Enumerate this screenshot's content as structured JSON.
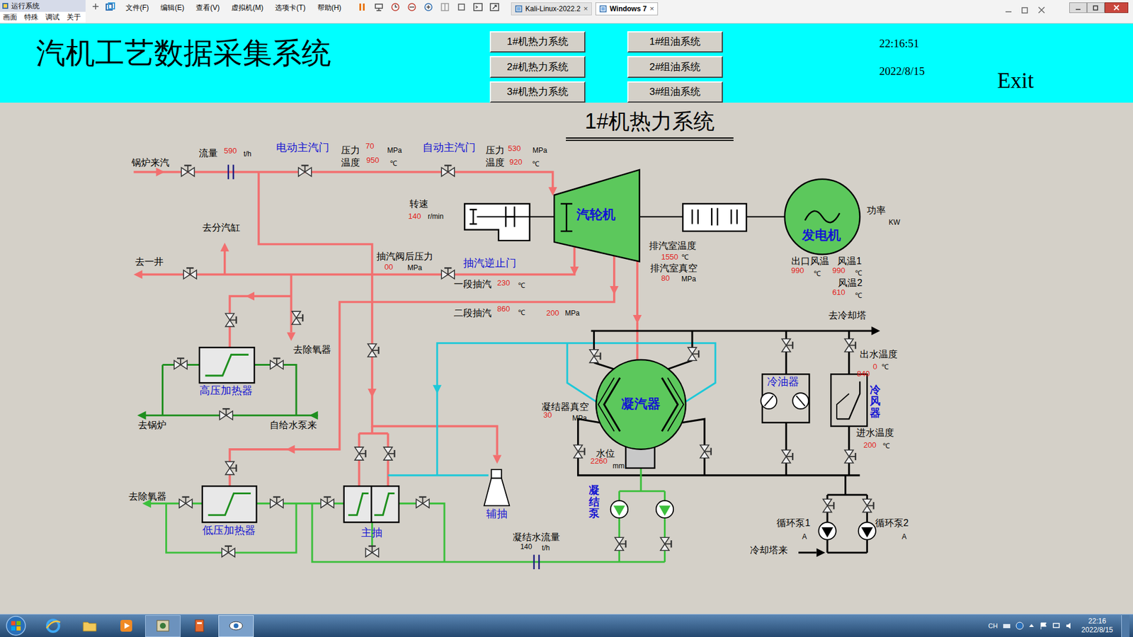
{
  "vm": {
    "app_title": "运行系统",
    "app_menu": [
      "画面",
      "特殊",
      "调试",
      "关于"
    ],
    "menu": [
      "文件(F)",
      "编辑(E)",
      "查看(V)",
      "虚拟机(M)",
      "选项卡(T)",
      "帮助(H)"
    ],
    "tabs": [
      {
        "label": "Kali-Linux-2022.2",
        "close": "×",
        "selected": false
      },
      {
        "label": "Windows 7",
        "close": "×",
        "selected": true
      }
    ]
  },
  "header": {
    "title": "汽机工艺数据采集系统",
    "nav": [
      "1#机热力系统",
      "2#机热力系统",
      "3#机热力系统",
      "1#组油系统",
      "2#组油系统",
      "3#组油系统"
    ],
    "time": "22:16:51",
    "date": "2022/8/15",
    "exit": "Exit"
  },
  "diagram": {
    "title": "1#机热力系统",
    "labels": [
      {
        "text": "锅炉来汽",
        "kind": "label"
      },
      {
        "text": "流量",
        "kind": "label"
      },
      {
        "text": "590",
        "kind": "value"
      },
      {
        "text": "t/h",
        "kind": "unit"
      },
      {
        "text": "电动主汽门",
        "kind": "name"
      },
      {
        "text": "压力",
        "kind": "label"
      },
      {
        "text": "70",
        "kind": "value"
      },
      {
        "text": "MPa",
        "kind": "unit"
      },
      {
        "text": "温度",
        "kind": "label"
      },
      {
        "text": "950",
        "kind": "value"
      },
      {
        "text": "℃",
        "kind": "unit"
      },
      {
        "text": "自动主汽门",
        "kind": "name"
      },
      {
        "text": "压力",
        "kind": "label"
      },
      {
        "text": "530",
        "kind": "value"
      },
      {
        "text": "MPa",
        "kind": "unit"
      },
      {
        "text": "温度",
        "kind": "label"
      },
      {
        "text": "920",
        "kind": "value"
      },
      {
        "text": "℃",
        "kind": "unit"
      },
      {
        "text": "转速",
        "kind": "label"
      },
      {
        "text": "140",
        "kind": "value"
      },
      {
        "text": "r/min",
        "kind": "unit"
      },
      {
        "text": "汽轮机",
        "kind": "bold"
      },
      {
        "text": "发电机",
        "kind": "bold"
      },
      {
        "text": "功率",
        "kind": "label"
      },
      {
        "text": "KW",
        "kind": "unit"
      },
      {
        "text": "排汽室温度",
        "kind": "label"
      },
      {
        "text": "1550",
        "kind": "value"
      },
      {
        "text": "℃",
        "kind": "unit"
      },
      {
        "text": "排汽室真空",
        "kind": "label"
      },
      {
        "text": "80",
        "kind": "value"
      },
      {
        "text": "MPa",
        "kind": "unit"
      },
      {
        "text": "出口风温",
        "kind": "label"
      },
      {
        "text": "990",
        "kind": "value"
      },
      {
        "text": "℃",
        "kind": "unit"
      },
      {
        "text": "风温1",
        "kind": "label"
      },
      {
        "text": "990",
        "kind": "value"
      },
      {
        "text": "℃",
        "kind": "unit"
      },
      {
        "text": "风温2",
        "kind": "label"
      },
      {
        "text": "610",
        "kind": "value"
      },
      {
        "text": "℃",
        "kind": "unit"
      },
      {
        "text": "去分汽缸",
        "kind": "label"
      },
      {
        "text": "去一井",
        "kind": "label"
      },
      {
        "text": "抽汽阀后压力",
        "kind": "label"
      },
      {
        "text": "00",
        "kind": "value"
      },
      {
        "text": "MPa",
        "kind": "unit"
      },
      {
        "text": "抽汽逆止门",
        "kind": "name"
      },
      {
        "text": "一段抽汽",
        "kind": "label"
      },
      {
        "text": "230",
        "kind": "value"
      },
      {
        "text": "℃",
        "kind": "unit"
      },
      {
        "text": "二段抽汽",
        "kind": "label"
      },
      {
        "text": "860",
        "kind": "value"
      },
      {
        "text": "℃",
        "kind": "unit"
      },
      {
        "text": "200",
        "kind": "value"
      },
      {
        "text": "MPa",
        "kind": "unit"
      },
      {
        "text": "去冷却塔",
        "kind": "label"
      },
      {
        "text": "出水温度",
        "kind": "label"
      },
      {
        "text": "0",
        "kind": "value"
      },
      {
        "text": "℃",
        "kind": "unit"
      },
      {
        "text": "840",
        "kind": "value"
      },
      {
        "text": "冷油器",
        "kind": "name"
      },
      {
        "text": "冷风器",
        "kind": "vertical"
      },
      {
        "text": "去除氧器",
        "kind": "label"
      },
      {
        "text": "高压加热器",
        "kind": "name"
      },
      {
        "text": "去锅炉",
        "kind": "label"
      },
      {
        "text": "自给水泵来",
        "kind": "label"
      },
      {
        "text": "凝结器真空",
        "kind": "label"
      },
      {
        "text": "30",
        "kind": "value"
      },
      {
        "text": "MPa",
        "kind": "unit"
      },
      {
        "text": "凝汽器",
        "kind": "bold"
      },
      {
        "text": "水位",
        "kind": "label"
      },
      {
        "text": "2260",
        "kind": "value"
      },
      {
        "text": "mm",
        "kind": "unit"
      },
      {
        "text": "进水温度",
        "kind": "label"
      },
      {
        "text": "200",
        "kind": "value"
      },
      {
        "text": "℃",
        "kind": "unit"
      },
      {
        "text": "凝结泵",
        "kind": "vertical"
      },
      {
        "text": "去除氧器",
        "kind": "label"
      },
      {
        "text": "低压加热器",
        "kind": "name"
      },
      {
        "text": "主抽",
        "kind": "name"
      },
      {
        "text": "辅抽",
        "kind": "name"
      },
      {
        "text": "凝结水流量",
        "kind": "label"
      },
      {
        "text": "140",
        "kind": "unit"
      },
      {
        "text": "t/h",
        "kind": "unit"
      },
      {
        "text": "循环泵1",
        "kind": "label"
      },
      {
        "text": "A",
        "kind": "unit"
      },
      {
        "text": "循环泵2",
        "kind": "label"
      },
      {
        "text": "A",
        "kind": "unit"
      },
      {
        "text": "冷却塔来",
        "kind": "label"
      }
    ]
  },
  "taskbar": {
    "lang": "CH",
    "time": "22:16",
    "date": "2022/8/15"
  }
}
